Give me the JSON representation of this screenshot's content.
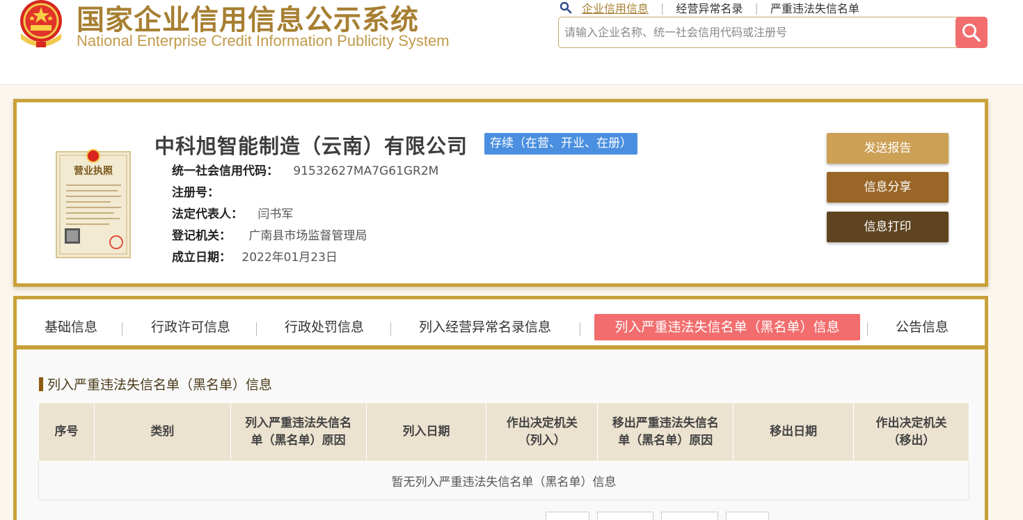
{
  "header": {
    "title_cn": "国家企业信用信息公示系统",
    "title_en": "National Enterprise Credit Information Publicity System",
    "nav": [
      {
        "label": "企业信用信息",
        "active": true
      },
      {
        "label": "经营异常名录",
        "active": false
      },
      {
        "label": "严重违法失信名单",
        "active": false
      }
    ],
    "search_placeholder": "请输入企业名称、统一社会信用代码或注册号"
  },
  "company": {
    "name": "中科旭智能制造（云南）有限公司",
    "status": "存续（在营、开业、在册）",
    "fields": [
      {
        "key": "统一社会信用代码：",
        "value": "91532627MA7G61GR2M"
      },
      {
        "key": "注册号：",
        "value": ""
      },
      {
        "key": "法定代表人：",
        "value": "闫书军"
      },
      {
        "key": "登记机关：",
        "value": "广南县市场监督管理局"
      },
      {
        "key": "成立日期：",
        "value": "2022年01月23日"
      }
    ],
    "license_title": "营业执照"
  },
  "actions": [
    {
      "label": "发送报告",
      "color": "#cca055"
    },
    {
      "label": "信息分享",
      "color": "#9a6627"
    },
    {
      "label": "信息打印",
      "color": "#5e4420"
    }
  ],
  "tabs": [
    {
      "label": "基础信息",
      "active": false
    },
    {
      "label": "行政许可信息",
      "active": false
    },
    {
      "label": "行政处罚信息",
      "active": false
    },
    {
      "label": "列入经营异常名录信息",
      "active": false
    },
    {
      "label": "列入严重违法失信名单（黑名单）信息",
      "active": true
    },
    {
      "label": "公告信息",
      "active": false
    }
  ],
  "section": {
    "title": "列入严重违法失信名单（黑名单）信息",
    "columns": [
      "序号",
      "类别",
      "列入严重违法失信名单（黑名单）原因",
      "列入日期",
      "作出决定机关（列入）",
      "移出严重违法失信名单（黑名单）原因",
      "移出日期",
      "作出决定机关（移出）"
    ],
    "empty_text": "暂无列入严重违法失信名单（黑名单）信息"
  },
  "colors": {
    "gold": "#c9a13b",
    "logo": "#a77f32",
    "accent_red": "#f26d6d",
    "status_blue": "#4a8fe0"
  }
}
